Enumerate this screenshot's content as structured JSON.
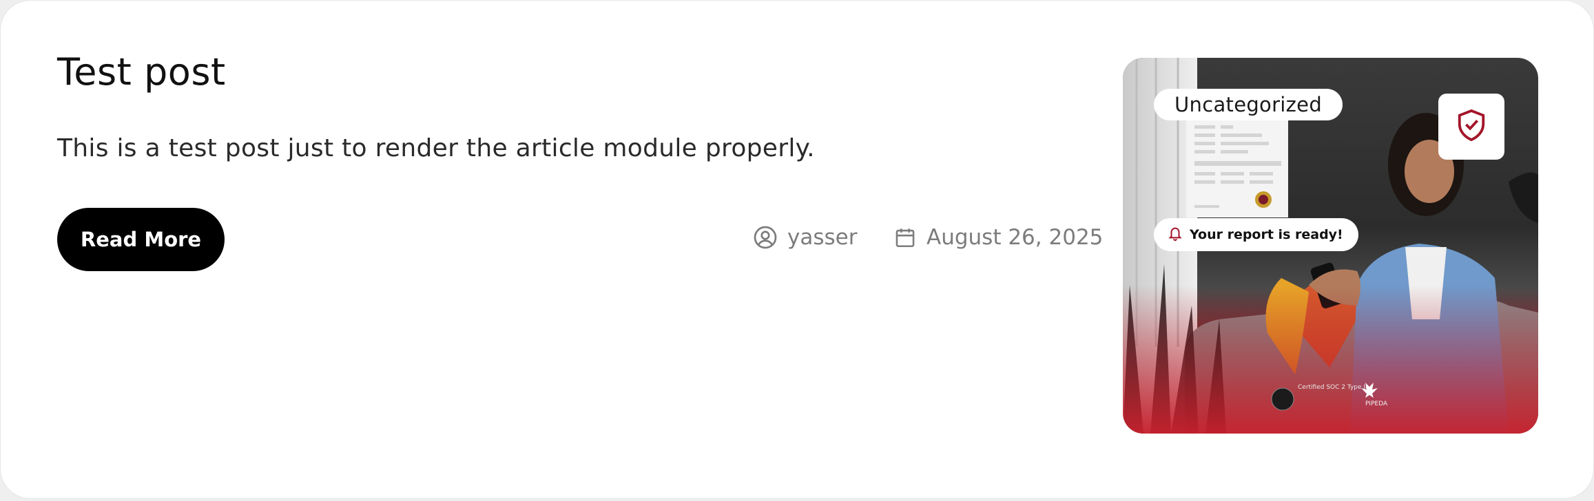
{
  "post": {
    "title": "Test post",
    "excerpt": "This is a test post just to render the article module properly.",
    "read_more_label": "Read More",
    "author": "yasser",
    "date": "August 26, 2025"
  },
  "image": {
    "category_tag": "Uncategorized",
    "notification_text": "Your report is ready!",
    "cert_text": "Certified SOC 2 Type II",
    "pipeda_text": "PIPEDA",
    "icons": [
      "shield-check-icon",
      "bell-icon",
      "maple-leaf-icon"
    ],
    "colors": {
      "accent_red": "#a3162a",
      "gradient_red": "#c5222e"
    }
  },
  "colors": {
    "button_bg": "#000000",
    "meta_text": "#7c7c7c",
    "title_text": "#111111"
  }
}
